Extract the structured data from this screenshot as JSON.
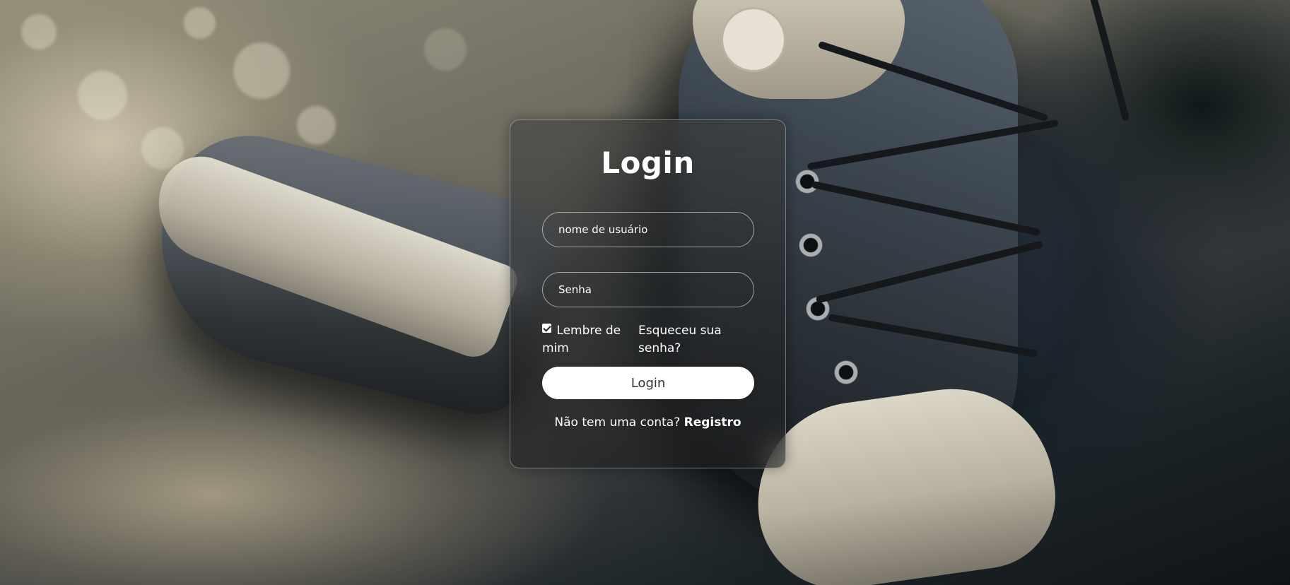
{
  "login_form": {
    "title": "Login",
    "username_placeholder": "nome de usuário",
    "password_placeholder": "Senha",
    "remember_label": "Lembre de mim",
    "remember_checked": true,
    "forgot_link": "Esqueceu sua senha?",
    "submit_label": "Login",
    "register_prompt": "Não tem uma conta?",
    "register_link": "Registro"
  },
  "icons": {
    "remember_checkbox": "checkbox-checked-icon"
  },
  "colors": {
    "text": "#ffffff",
    "button_bg": "#ffffff",
    "button_text": "#333333"
  }
}
